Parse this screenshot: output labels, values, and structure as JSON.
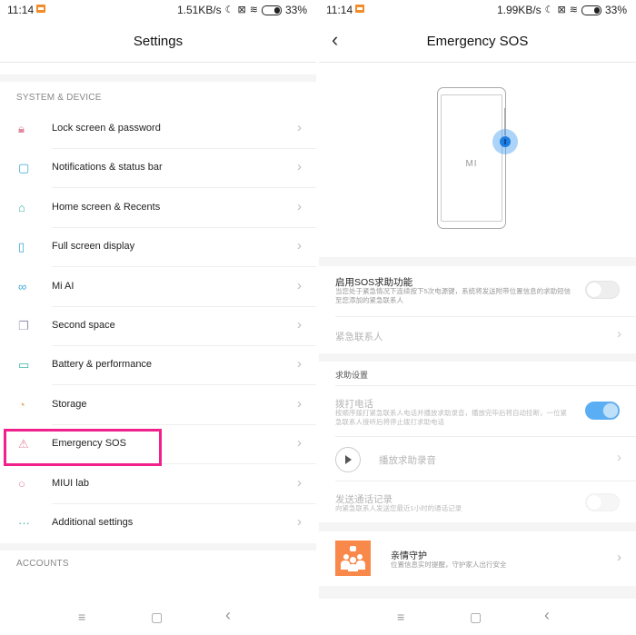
{
  "left_screen": {
    "status_bar": {
      "time": "11:14",
      "net_speed": "1.51KB/s",
      "battery": "33%"
    },
    "title": "Settings",
    "section_system": "SYSTEM & DEVICE",
    "items": [
      {
        "label": "Lock screen & password",
        "icon": "lock-icon",
        "color": "#e38aa0"
      },
      {
        "label": "Notifications & status bar",
        "icon": "notification-icon",
        "color": "#3ba7d6"
      },
      {
        "label": "Home screen & Recents",
        "icon": "home-icon",
        "color": "#3cb5a4"
      },
      {
        "label": "Full screen display",
        "icon": "phone-display-icon",
        "color": "#3ba7d6"
      },
      {
        "label": "Mi AI",
        "icon": "mi-ai-icon",
        "color": "#3ba7d6"
      },
      {
        "label": "Second space",
        "icon": "second-space-icon",
        "color": "#9a9ab0"
      },
      {
        "label": "Battery & performance",
        "icon": "battery-icon",
        "color": "#3cb5a4"
      },
      {
        "label": "Storage",
        "icon": "storage-pie-icon",
        "color": "#e0b07a"
      },
      {
        "label": "Emergency SOS",
        "icon": "warning-icon",
        "color": "#e38aa0"
      },
      {
        "label": "MIUI lab",
        "icon": "lab-flask-icon",
        "color": "#e38aa0"
      },
      {
        "label": "Additional settings",
        "icon": "more-dots-icon",
        "color": "#3cb5a4"
      }
    ],
    "section_accounts": "ACCOUNTS",
    "highlight_color": "#f0208c"
  },
  "right_screen": {
    "status_bar": {
      "time": "11:14",
      "net_speed": "1.99KB/s",
      "battery": "33%"
    },
    "title": "Emergency SOS",
    "illustration_logo": "MI",
    "enable_sos": {
      "title": "启用SOS求助功能",
      "desc": "当您处于紧急情况下连续按下5次电源键，系统将发送附带位置信息的求助短信至您添加的紧急联系人",
      "enabled": false
    },
    "emergency_contacts": "紧急联系人",
    "help_settings_header": "求助设置",
    "call": {
      "title": "拨打电话",
      "desc": "按顺序拨打紧急联系人电话并播放求助录音，播放完毕后将自动挂断，一位紧急联系人接听后将停止拨打求助电话",
      "enabled": true
    },
    "play_recording": "播放求助录音",
    "send_call_log": {
      "title": "发送通话记录",
      "desc": "向紧急联系人发送您最近1小时的通话记录",
      "enabled": false
    },
    "family_guard": {
      "title": "亲情守护",
      "desc": "位置信息实时提醒，守护家人出行安全",
      "icon_color": "#f8894a"
    },
    "accent_color": "#5aaef3"
  },
  "navbar": {
    "menu": "≡",
    "home": "▢",
    "back": "‹"
  }
}
